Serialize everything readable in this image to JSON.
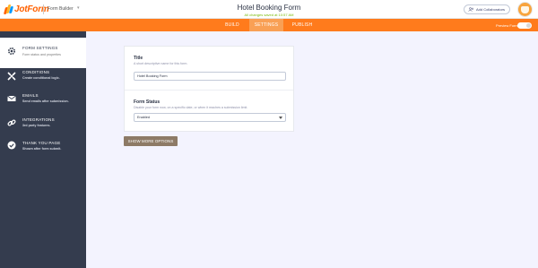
{
  "header": {
    "logo_text": "JotForm",
    "app_name": "Form Builder",
    "form_title": "Hotel Booking Form",
    "save_status": "All changes saved at 10:57 AM",
    "collab_label": "Add Collaborators"
  },
  "nav": {
    "tabs": [
      {
        "label": "BUILD",
        "active": false
      },
      {
        "label": "SETTINGS",
        "active": true
      },
      {
        "label": "PUBLISH",
        "active": false
      }
    ],
    "preview_label": "Preview Form"
  },
  "sidebar": {
    "items": [
      {
        "title": "FORM SETTINGS",
        "subtitle": "Form status and properties",
        "icon": "gear-icon",
        "active": true
      },
      {
        "title": "CONDITIONS",
        "subtitle": "Create conditional logic.",
        "icon": "conditions-icon",
        "active": false
      },
      {
        "title": "EMAILS",
        "subtitle": "Send emails after submission.",
        "icon": "envelope-icon",
        "active": false
      },
      {
        "title": "INTEGRATIONS",
        "subtitle": "3rd party features.",
        "icon": "link-icon",
        "active": false
      },
      {
        "title": "THANK YOU PAGE",
        "subtitle": "Shown after form submit.",
        "icon": "check-circle-icon",
        "active": false
      }
    ]
  },
  "settings": {
    "title_label": "Title",
    "title_desc": "A short descriptive name for this form.",
    "title_value": "Hotel Booking Form",
    "status_label": "Form Status",
    "status_desc": "Disable your form now, on a specific date, or when it reaches a submission limit.",
    "status_value": "Enabled",
    "more_button": "SHOW MORE OPTIONS"
  },
  "colors": {
    "brand_orange": "#ff7b1c",
    "sidebar_bg": "#343c4e",
    "canvas_bg": "#f3f3fe",
    "button_brown": "#8d7a66",
    "save_green": "#78bb07"
  }
}
